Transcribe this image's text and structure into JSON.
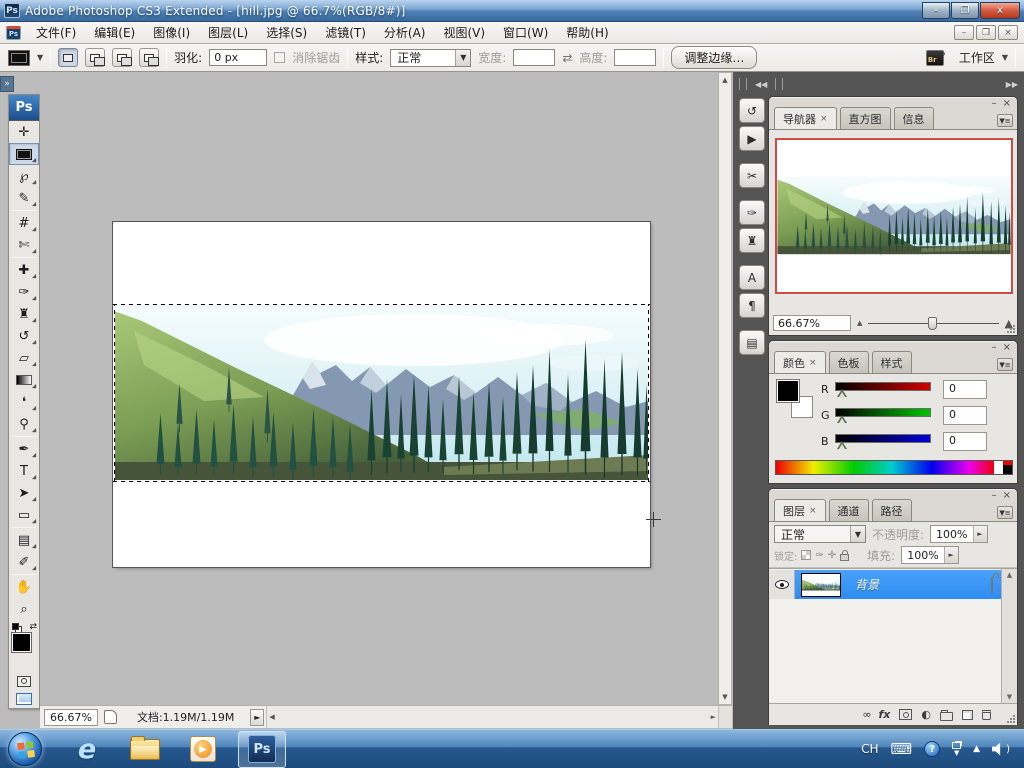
{
  "window": {
    "title": "Adobe Photoshop CS3 Extended - [hill.jpg @ 66.7%(RGB/8#)]",
    "ps_logo": "Ps"
  },
  "icons": {
    "minimize": "–",
    "restore": "❐",
    "close": "x",
    "doc_minimize": "–",
    "doc_restore": "❐",
    "doc_close": "×",
    "collapse_chevrons": "»",
    "collapse_left": "◀◀",
    "expand_right": "▶▶",
    "panel_menu": "▼≡",
    "tab_close": "×",
    "arrow_up": "▲",
    "arrow_down": "▼",
    "arrow_left": "◀",
    "arrow_right": "►",
    "status_pop": "►",
    "swap": "⇄",
    "dropdown": "▼",
    "spin_right": "►",
    "mountain_small": "▲",
    "mountain_big": "▲",
    "keyboard": "⌨",
    "help": "?",
    "play": "▶",
    "fx": "fx",
    "link": "∞",
    "adjustment": "◐"
  },
  "menubar": {
    "items": [
      "文件(F)",
      "编辑(E)",
      "图像(I)",
      "图层(L)",
      "选择(S)",
      "滤镜(T)",
      "分析(A)",
      "视图(V)",
      "窗口(W)",
      "帮助(H)"
    ]
  },
  "optionsbar": {
    "feather_label": "羽化:",
    "feather_value": "0 px",
    "antialias_label": "消除锯齿",
    "style_label": "样式:",
    "style_value": "正常",
    "width_label": "宽度:",
    "height_label": "高度:",
    "refine_edge_label": "调整边缘…",
    "bridge_label": "Br",
    "workspace_label": "工作区"
  },
  "toolbox": {
    "tools": [
      {
        "name": "move-tool",
        "glyph": "✛"
      },
      {
        "name": "rectangular-marquee-tool",
        "glyph": ""
      },
      {
        "name": "lasso-tool",
        "glyph": "℘"
      },
      {
        "name": "quick-selection-tool",
        "glyph": "✎"
      },
      {
        "name": "crop-tool",
        "glyph": "#"
      },
      {
        "name": "slice-tool",
        "glyph": "✄"
      },
      {
        "name": "healing-brush-tool",
        "glyph": "✚"
      },
      {
        "name": "brush-tool",
        "glyph": "✑"
      },
      {
        "name": "clone-stamp-tool",
        "glyph": "♜"
      },
      {
        "name": "history-brush-tool",
        "glyph": "↺"
      },
      {
        "name": "eraser-tool",
        "glyph": "▱"
      },
      {
        "name": "gradient-tool",
        "glyph": ""
      },
      {
        "name": "blur-tool",
        "glyph": "❛"
      },
      {
        "name": "dodge-tool",
        "glyph": "⚲"
      },
      {
        "name": "pen-tool",
        "glyph": "✒"
      },
      {
        "name": "type-tool",
        "glyph": "T"
      },
      {
        "name": "path-selection-tool",
        "glyph": "➤"
      },
      {
        "name": "shape-tool",
        "glyph": "▭"
      },
      {
        "name": "notes-tool",
        "glyph": "▤"
      },
      {
        "name": "eyedropper-tool",
        "glyph": "✐"
      },
      {
        "name": "hand-tool",
        "glyph": "✋"
      },
      {
        "name": "zoom-tool",
        "glyph": "⌕"
      }
    ]
  },
  "statusbar": {
    "zoom": "66.67%",
    "doc_info": "文档:1.19M/1.19M"
  },
  "dock_icons": [
    {
      "name": "history",
      "glyph": "↺"
    },
    {
      "name": "actions",
      "glyph": "▶"
    },
    {
      "name": "tool-presets",
      "glyph": "✂"
    },
    {
      "name": "brushes",
      "glyph": "✑"
    },
    {
      "name": "clone-source",
      "glyph": "♜"
    },
    {
      "name": "character",
      "glyph": "A"
    },
    {
      "name": "paragraph",
      "glyph": "¶"
    },
    {
      "name": "layer-comps",
      "glyph": "▤"
    }
  ],
  "panels": {
    "navigator": {
      "tabs": [
        "导航器",
        "直方图",
        "信息"
      ],
      "zoom_value": "66.67%"
    },
    "color": {
      "tabs": [
        "颜色",
        "色板",
        "样式"
      ],
      "channels": [
        {
          "label": "R",
          "value": "0"
        },
        {
          "label": "G",
          "value": "0"
        },
        {
          "label": "B",
          "value": "0"
        }
      ]
    },
    "layers": {
      "tabs": [
        "图层",
        "通道",
        "路径"
      ],
      "blend_mode": "正常",
      "opacity_label": "不透明度:",
      "opacity_value": "100%",
      "lock_label": "锁定:",
      "fill_label": "填充:",
      "fill_value": "100%",
      "layer_name": "背景"
    }
  },
  "taskbar": {
    "input_indicator": "CH",
    "wmp_play": "▶"
  },
  "colors": {
    "selection_blue": "#3f9bfb",
    "navigator_border": "#cf4b45",
    "foreground": "#000000",
    "background": "#ffffff"
  }
}
